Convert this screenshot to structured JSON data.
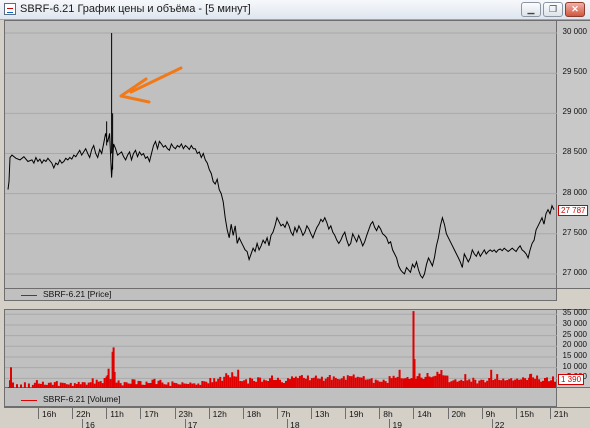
{
  "window": {
    "title": "SBRF-6.21 График цены и объёма - [5 минут]",
    "buttons": [
      "minimize",
      "restore",
      "close"
    ]
  },
  "colors": {
    "price_line": "#000000",
    "volume_bars": "#e00000",
    "arrow": "#f07a1a",
    "panel_bg": "#c0c0c0",
    "last_price": "#d00000"
  },
  "chart_data": [
    {
      "type": "line",
      "panel": "price",
      "legend": "SBRF-6.21 [Price]",
      "y_ticks": [
        "30 000",
        "29 500",
        "29 000",
        "28 500",
        "28 000",
        "27 500",
        "27 000"
      ],
      "ylim": [
        26800,
        30150
      ],
      "last_value_label": "27 787",
      "x": [
        0,
        1,
        2,
        4,
        8,
        12,
        16,
        20,
        24,
        26,
        28,
        30,
        32,
        34,
        36,
        38,
        40,
        42,
        44,
        46,
        48,
        50,
        52,
        54,
        56,
        58,
        60,
        62,
        64,
        66,
        68,
        70,
        72,
        74,
        76,
        78,
        80,
        82,
        84,
        86,
        88,
        90,
        92,
        94,
        96,
        98,
        100,
        102,
        104,
        106,
        108,
        110,
        112,
        114,
        116,
        118,
        120,
        122,
        124,
        126,
        128,
        130,
        132,
        134,
        136,
        138,
        140,
        142,
        144,
        146,
        148,
        150,
        152,
        154,
        156,
        158,
        160,
        162,
        164,
        166,
        168,
        170,
        172,
        174,
        176,
        178,
        180,
        182,
        184,
        186,
        188,
        190,
        192,
        194,
        196,
        198,
        200,
        202,
        204,
        206,
        208,
        210,
        212,
        214,
        216,
        218,
        220,
        222,
        224,
        226,
        228,
        230,
        232,
        234,
        236,
        238,
        240,
        242,
        244,
        246,
        248,
        250,
        252,
        254,
        256,
        258,
        260,
        262,
        264,
        266,
        268,
        270,
        272,
        274,
        276,
        278,
        280,
        282,
        284,
        286,
        288,
        290,
        292,
        294,
        296,
        298,
        300,
        302,
        304,
        306,
        308,
        310,
        312,
        314,
        316,
        318,
        320,
        322,
        324,
        326,
        328,
        330,
        332,
        334,
        336,
        338,
        340,
        342,
        344,
        346,
        348,
        350,
        352,
        354,
        356,
        358,
        360,
        362,
        364,
        366,
        368,
        370,
        372,
        374,
        376,
        378,
        380,
        382,
        384,
        386,
        388,
        390,
        392,
        394,
        396,
        398,
        400,
        402,
        404,
        406,
        408,
        410,
        412,
        414,
        416,
        418,
        420,
        422,
        424,
        426,
        428,
        430,
        432,
        434,
        436,
        438,
        440,
        442,
        444,
        446,
        448,
        450,
        452,
        454,
        456,
        458,
        460,
        462,
        464,
        466,
        468,
        470,
        472,
        474,
        476,
        478,
        480,
        482,
        484,
        486,
        488,
        490,
        492,
        494,
        496,
        498,
        500,
        502,
        504,
        506,
        508,
        510,
        512,
        514,
        516,
        518,
        520,
        522,
        524,
        526,
        528,
        530,
        532,
        534,
        536,
        538,
        540,
        542,
        544,
        546,
        548
      ],
      "values": [
        28050,
        28150,
        28450,
        28480,
        28440,
        28420,
        28460,
        28400,
        28420,
        28380,
        28450,
        28400,
        28430,
        28380,
        28420,
        28400,
        28440,
        28410,
        28380,
        28320,
        28380,
        28360,
        28420,
        28380,
        28400,
        28440,
        28420,
        28450,
        28430,
        28480,
        28460,
        28500,
        28540,
        28480,
        28520,
        28560,
        28500,
        28450,
        28550,
        28600,
        28500,
        28450,
        28550,
        28500,
        28620,
        28750,
        28640,
        28750,
        28200,
        28620,
        28560,
        28480,
        28500,
        28520,
        28460,
        28420,
        28480,
        28520,
        28420,
        28500,
        28540,
        28460,
        28520,
        28480,
        28500,
        28440,
        28460,
        28400,
        28500,
        28600,
        28650,
        28560,
        28650,
        28620,
        28580,
        28600,
        28560,
        28540,
        28620,
        28580,
        28560,
        28600,
        28580,
        28620,
        28560,
        28600,
        28580,
        28550,
        28600,
        28560,
        28560,
        28500,
        28520,
        28450,
        28500,
        28420,
        28380,
        28300,
        28250,
        28150,
        28120,
        28180,
        28050,
        28000,
        27900,
        27700,
        27550,
        27450,
        27620,
        27480,
        27600,
        27380,
        27450,
        27400,
        27350,
        27300,
        27280,
        27180,
        27250,
        27320,
        27280,
        27380,
        27300,
        27350,
        27420,
        27380,
        27450,
        27350,
        27480,
        27520,
        27600,
        27700,
        27650,
        27600,
        27620,
        27580,
        27650,
        27600,
        27520,
        27480,
        27580,
        27520,
        27600,
        27550,
        27480,
        27520,
        27600,
        27560,
        27500,
        27450,
        27520,
        27580,
        27620,
        27680,
        27650,
        27700,
        27640,
        27560,
        27600,
        27520,
        27480,
        27420,
        27380,
        27420,
        27480,
        27520,
        27420,
        27350,
        27380,
        27500,
        27450,
        27400,
        27480,
        27420,
        27350,
        27400,
        27480,
        27550,
        27620,
        27650,
        27580,
        27540,
        27600,
        27560,
        27500,
        27480,
        27450,
        27380,
        27400,
        27300,
        27250,
        27200,
        27100,
        27050,
        27020,
        27000,
        27080,
        27050,
        27020,
        27120,
        27080,
        27150,
        27050,
        26980,
        26950,
        27000,
        27120,
        27200,
        27150,
        27100,
        27200,
        27350,
        27450,
        27600,
        27700,
        27620,
        27500,
        27450,
        27400,
        27350,
        27300,
        27250,
        27200,
        27150,
        27080,
        27250,
        27200,
        27150,
        27200,
        27300,
        27250,
        27220,
        27280,
        27220,
        27260,
        27300,
        27250,
        27280,
        27300,
        27280,
        27300,
        27270,
        27300,
        27310,
        27290,
        27320,
        27300,
        27280,
        27300,
        27320,
        27300,
        27280,
        27320,
        27350,
        27300,
        27280,
        27250,
        27200,
        27300,
        27380,
        27420,
        27550,
        27600,
        27650,
        27700,
        27620,
        27750,
        27800,
        27750,
        27850,
        27800,
        27750,
        27820,
        27780,
        27850,
        27800,
        27780,
        27820,
        27800,
        27900,
        27960,
        27880,
        27850,
        27900,
        27820,
        27787
      ],
      "spikes": [
        {
          "x": 104,
          "value": 30000,
          "base": 28500
        },
        {
          "x": 105,
          "value": 29000,
          "base": 28300
        },
        {
          "x": 99,
          "value": 28900,
          "base": 28600
        }
      ]
    },
    {
      "type": "bar",
      "panel": "volume",
      "legend": "SBRF-6.21 [Volume]",
      "y_ticks": [
        "35 000",
        "30 000",
        "25 000",
        "20 000",
        "15 000",
        "10 000",
        "5 000"
      ],
      "ylim": [
        0,
        37000
      ],
      "last_value_label": "1 390",
      "spikes": [
        {
          "x": 99,
          "value": 6500
        },
        {
          "x": 100,
          "value": 9500
        },
        {
          "x": 105,
          "value": 19500
        },
        {
          "x": 106,
          "value": 8000
        },
        {
          "x": 294,
          "value": 6500
        },
        {
          "x": 344,
          "value": 6000
        },
        {
          "x": 406,
          "value": 36500
        },
        {
          "x": 407,
          "value": 14000
        },
        {
          "x": 392,
          "value": 9000
        },
        {
          "x": 420,
          "value": 7500
        },
        {
          "x": 484,
          "value": 9000
        },
        {
          "x": 490,
          "value": 7000
        },
        {
          "x": 523,
          "value": 7000
        }
      ]
    }
  ],
  "time_axis": {
    "hours": [
      "16h",
      "22h",
      "11h",
      "17h",
      "23h",
      "12h",
      "18h",
      "7h",
      "13h",
      "19h",
      "8h",
      "14h",
      "20h",
      "9h",
      "15h",
      "21h"
    ],
    "dates": [
      "16",
      "17",
      "18",
      "19",
      "22"
    ]
  }
}
